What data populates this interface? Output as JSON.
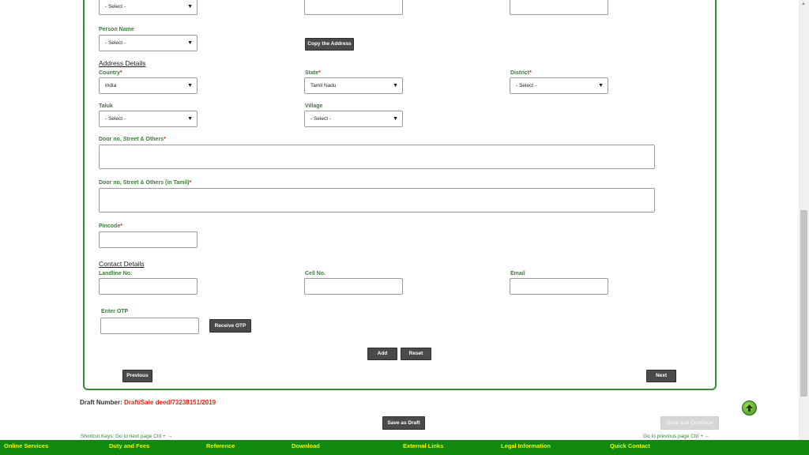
{
  "top_row": {
    "select_value": "- Select -"
  },
  "person": {
    "label": "Person Name",
    "select_value": "- Select -",
    "copy_button": "Copy the Address"
  },
  "address": {
    "heading": "Address Details",
    "country_label": "Country",
    "country_value": "India",
    "state_label": "State",
    "state_value": "Tamil Nadu",
    "district_label": "District",
    "district_value": "- Select -",
    "taluk_label": "Taluk",
    "taluk_value": "- Select -",
    "village_label": "Village",
    "village_value": "- Select -",
    "door_label": "Door no, Street & Others",
    "door_tamil_label": "Door no, Street & Others (in Tamil)",
    "pincode_label": "Pincode",
    "required_marker": "*"
  },
  "contact": {
    "heading": "Contact Details",
    "landline_label": "Landline No.",
    "cell_label": "Cell No.",
    "email_label": "Email",
    "otp_label": "Enter OTP",
    "otp_button": "Receive OTP"
  },
  "actions": {
    "add": "Add",
    "reset": "Reset",
    "previous": "Previous",
    "next": "Next"
  },
  "draft": {
    "label": "Draft Number:",
    "value": "Draft/Sale deed/73238151/2019"
  },
  "bottom": {
    "save_draft": "Save as Draft",
    "save_continue": "Save and Continue",
    "shortcut_next": "Shortcut Keys: Go to next page Ctrl + →",
    "shortcut_prev": "Go to previous page Ctrl + ←"
  },
  "footer": {
    "items": [
      "Online Services",
      "Duty and Fees",
      "Reference",
      "Download",
      "External Links",
      "Legal Information",
      "Quick Contact"
    ]
  },
  "colors": {
    "label_green": "#3b7d3b",
    "panel_border": "#3c8b3c",
    "footer_bg": "#0f8a0f",
    "footer_text": "#f2f200",
    "required": "#e0241b"
  },
  "icons": {
    "back_to_top": "arrow-up-icon",
    "dropdown": "chevron-down-icon"
  }
}
